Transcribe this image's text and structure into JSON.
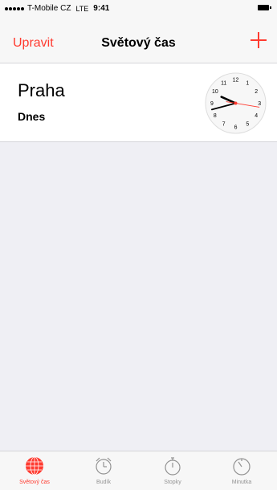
{
  "status_bar": {
    "carrier": "T-Mobile CZ",
    "network": "LTE",
    "time": "9:41"
  },
  "nav": {
    "edit_label": "Upravit",
    "title": "Světový čas"
  },
  "clocks": [
    {
      "city": "Praha",
      "day": "Dnes",
      "dial_numbers": [
        "12",
        "1",
        "2",
        "3",
        "4",
        "5",
        "6",
        "7",
        "8",
        "9",
        "10",
        "11"
      ]
    }
  ],
  "tabs": [
    {
      "label": "Světový čas",
      "icon": "globe-icon",
      "active": true
    },
    {
      "label": "Budík",
      "icon": "alarm-clock-icon",
      "active": false
    },
    {
      "label": "Stopky",
      "icon": "stopwatch-icon",
      "active": false
    },
    {
      "label": "Minutka",
      "icon": "timer-icon",
      "active": false
    }
  ],
  "colors": {
    "accent": "#ff3b30",
    "background": "#efeff4",
    "bar": "#f7f7f7",
    "inactive_tab": "#929292"
  }
}
